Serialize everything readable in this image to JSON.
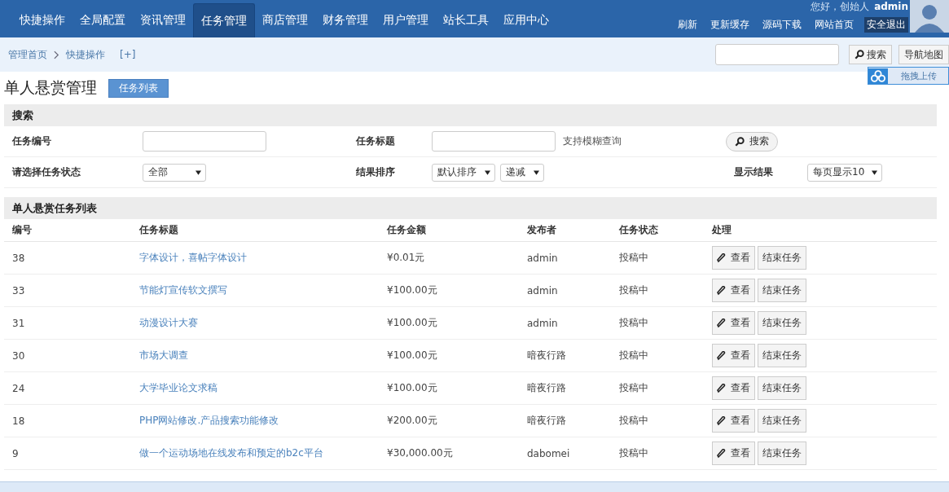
{
  "nav": {
    "tabs": [
      {
        "label": "快捷操作",
        "selected": false
      },
      {
        "label": "全局配置",
        "selected": false
      },
      {
        "label": "资讯管理",
        "selected": false
      },
      {
        "label": "任务管理",
        "selected": true
      },
      {
        "label": "商店管理",
        "selected": false
      },
      {
        "label": "财务管理",
        "selected": false
      },
      {
        "label": "用户管理",
        "selected": false
      },
      {
        "label": "站长工具",
        "selected": false
      },
      {
        "label": "应用中心",
        "selected": false
      }
    ],
    "greeting": "您好，创始人",
    "user": "admin",
    "links": [
      {
        "label": "刷新",
        "kind": "link"
      },
      {
        "label": "更新缓存",
        "kind": "link"
      },
      {
        "label": "源码下载",
        "kind": "link"
      },
      {
        "label": "网站首页",
        "kind": "link"
      },
      {
        "label": "安全退出",
        "kind": "exit"
      }
    ]
  },
  "breadcrumb": {
    "items": [
      "管理首页",
      "快捷操作"
    ],
    "add": "[+]"
  },
  "top_search": {
    "button": "搜索",
    "map_button": "导航地图"
  },
  "upload_widget": {
    "label": "拖拽上传"
  },
  "page": {
    "title": "单人悬赏管理",
    "tab_button": "任务列表"
  },
  "search": {
    "title": "搜索",
    "id_label": "任务编号",
    "title_label": "任务标题",
    "hint": "支持模糊查询",
    "button": "搜索",
    "status_label": "请选择任务状态",
    "status_value": "全部",
    "sort_label": "结果排序",
    "sort_value": "默认排序",
    "order_value": "递减",
    "show_label": "显示结果",
    "show_value": "每页显示10"
  },
  "table": {
    "title": "单人悬赏任务列表",
    "columns": [
      "编号",
      "任务标题",
      "任务金额",
      "发布者",
      "任务状态",
      "处理"
    ],
    "rows": [
      {
        "id": "38",
        "title": "字体设计，喜帖字体设计",
        "amount": "¥0.01元",
        "publisher": "admin",
        "status": "投稿中",
        "actions": [
          "查看",
          "结束任务"
        ]
      },
      {
        "id": "33",
        "title": "节能灯宣传软文撰写",
        "amount": "¥100.00元",
        "publisher": "admin",
        "status": "投稿中",
        "actions": [
          "查看",
          "结束任务"
        ]
      },
      {
        "id": "31",
        "title": "动漫设计大赛",
        "amount": "¥100.00元",
        "publisher": "admin",
        "status": "投稿中",
        "actions": [
          "查看",
          "结束任务"
        ]
      },
      {
        "id": "30",
        "title": "市场大调查",
        "amount": "¥100.00元",
        "publisher": "暗夜行路",
        "status": "投稿中",
        "actions": [
          "查看",
          "结束任务"
        ]
      },
      {
        "id": "24",
        "title": "大学毕业论文求稿",
        "amount": "¥100.00元",
        "publisher": "暗夜行路",
        "status": "投稿中",
        "actions": [
          "查看",
          "结束任务"
        ]
      },
      {
        "id": "18",
        "title": "PHP网站修改.产品搜索功能修改",
        "amount": "¥200.00元",
        "publisher": "暗夜行路",
        "status": "投稿中",
        "actions": [
          "查看",
          "结束任务"
        ]
      },
      {
        "id": "9",
        "title": "做一个运动场地在线发布和预定的b2c平台",
        "amount": "¥30,000.00元",
        "publisher": "dabomei",
        "status": "投稿中",
        "actions": [
          "查看",
          "结束任务"
        ]
      }
    ]
  }
}
